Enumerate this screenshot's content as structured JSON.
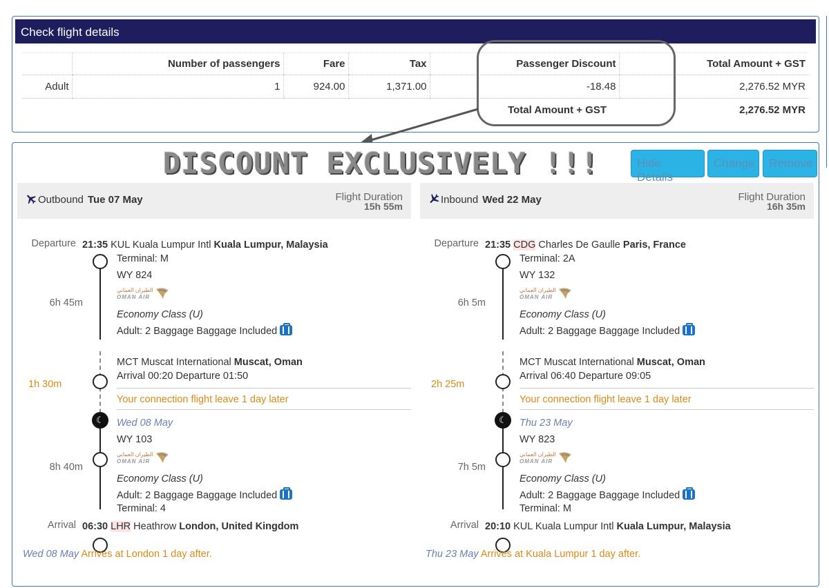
{
  "panel_title": "Check flight details",
  "fare_table": {
    "headers": [
      "",
      "Number of passengers",
      "Fare",
      "Tax",
      "Passenger Discount",
      "Total Amount + GST"
    ],
    "rows": [
      [
        "Adult",
        "1",
        "924.00",
        "1,371.00",
        "-18.48",
        "2,276.52 MYR"
      ]
    ],
    "total_label": "Total Amount + GST",
    "total_value": "2,276.52 MYR"
  },
  "banner": "DISCOUNT EXCLUSIVELY !!!",
  "buttons": {
    "hide": "Hide Details",
    "change": "Change",
    "remove": "Remove"
  },
  "outbound": {
    "direction": "Outbound",
    "date": "Tue 07 May",
    "duration_label": "Flight Duration",
    "duration": "15h 55m",
    "departure_label": "Departure",
    "dep_time": "21:35",
    "dep_code": "KUL",
    "dep_airport": "Kuala Lumpur Intl",
    "dep_city": "Kuala Lumpur, Malaysia",
    "dep_terminal": "Terminal: M",
    "seg1_flight": "WY 824",
    "seg1_duration": "6h 45m",
    "seg1_class": "Economy Class (U)",
    "seg1_baggage": "Adult: 2 Baggage Baggage Included",
    "conn_code": "MCT",
    "conn_airport": "Muscat International",
    "conn_city": "Muscat, Oman",
    "conn_times": "Arrival 00:20 Departure 01:50",
    "layover": "1h 30m",
    "conn_note": "Your connection flight leave 1 day later",
    "seg2_date": "Wed 08 May",
    "seg2_flight": "WY 103",
    "seg2_duration": "8h 40m",
    "seg2_class": "Economy Class (U)",
    "seg2_baggage": "Adult: 2 Baggage Baggage Included",
    "arr_terminal": "Terminal: 4",
    "arrival_label": "Arrival",
    "arr_time": "06:30",
    "arr_code": "LHR",
    "arr_airport": "Heathrow",
    "arr_city": "London, United Kingdom",
    "footer_date": "Wed 08 May",
    "footer_note": "Arrives at London 1 day after."
  },
  "inbound": {
    "direction": "Inbound",
    "date": "Wed 22 May",
    "duration_label": "Flight Duration",
    "duration": "16h 35m",
    "departure_label": "Departure",
    "dep_time": "21:35",
    "dep_code": "CDG",
    "dep_airport": "Charles De Gaulle",
    "dep_city": "Paris, France",
    "dep_terminal": "Terminal: 2A",
    "seg1_flight": "WY 132",
    "seg1_duration": "6h 5m",
    "seg1_class": "Economy Class (U)",
    "seg1_baggage": "Adult: 2 Baggage Baggage Included",
    "conn_code": "MCT",
    "conn_airport": "Muscat International",
    "conn_city": "Muscat, Oman",
    "conn_times": "Arrival 06:40 Departure 09:05",
    "layover": "2h 25m",
    "conn_note": "Your connection flight leave 1 day later",
    "seg2_date": "Thu 23 May",
    "seg2_flight": "WY 823",
    "seg2_duration": "7h 5m",
    "seg2_class": "Economy Class (U)",
    "seg2_baggage": "Adult: 2 Baggage Baggage Included",
    "arr_terminal": "Terminal: M",
    "arrival_label": "Arrival",
    "arr_time": "20:10",
    "arr_code": "KUL",
    "arr_airport": "Kuala Lumpur Intl",
    "arr_city": "Kuala Lumpur, Malaysia",
    "footer_date": "Thu 23 May",
    "footer_note": "Arrives at Kuala Lumpur 1 day after."
  },
  "airline_logo": {
    "arabic": "الطيران العماني",
    "latin": "OMAN AIR"
  },
  "colors": {
    "header_bg": "#1e1d5e",
    "button_bg": "#2bb3e6",
    "accent_orange": "#d98b16",
    "date_blue": "#6b7fb5",
    "border_blue": "#3a78b8"
  }
}
